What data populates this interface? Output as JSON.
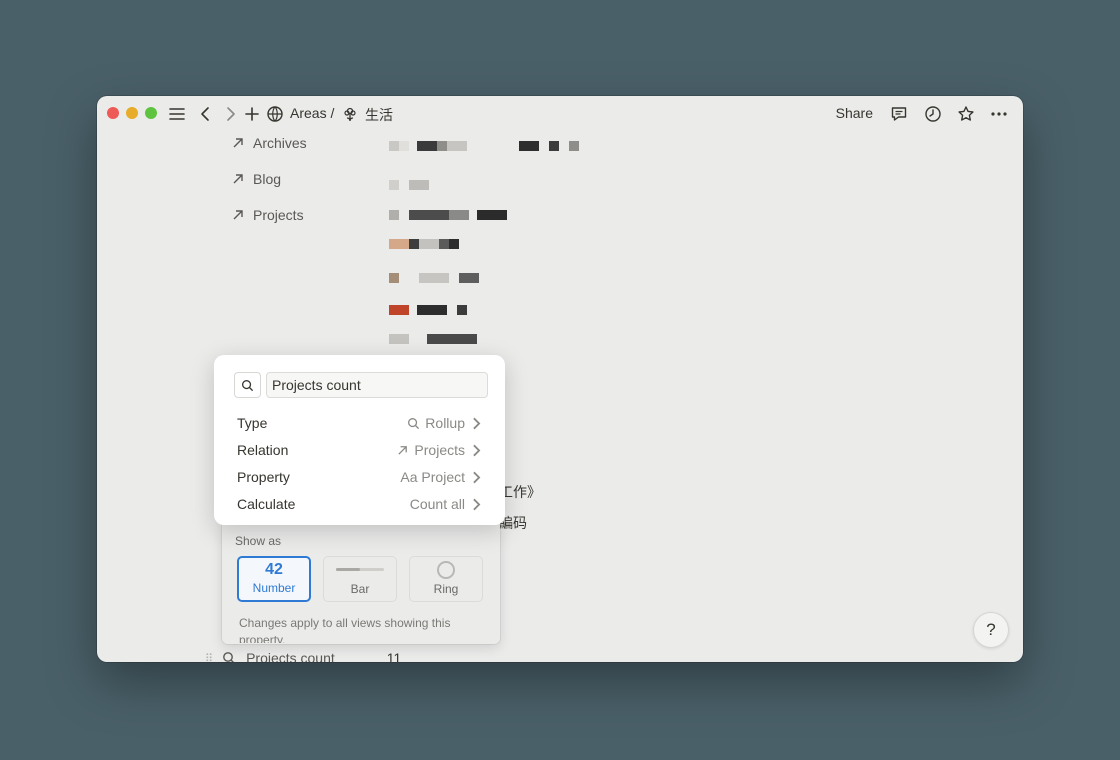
{
  "titlebar": {
    "breadcrumb_parent": "Areas /",
    "breadcrumb_page": "生活",
    "share_label": "Share"
  },
  "properties": [
    {
      "label": "Archives"
    },
    {
      "label": "Blog"
    },
    {
      "label": "Projects"
    }
  ],
  "background_text": {
    "frag1": "工作》",
    "frag2": "編码",
    "bottom_prop_label": "Projects count",
    "bottom_prop_value": "11"
  },
  "menu": {
    "name_value": "Projects count",
    "rows": [
      {
        "label": "Type",
        "value": "Rollup",
        "icon": "search-icon"
      },
      {
        "label": "Relation",
        "value": "Projects",
        "icon": "arrow-up-right-icon"
      },
      {
        "label": "Property",
        "value": "Aa Project",
        "icon": ""
      },
      {
        "label": "Calculate",
        "value": "Count all",
        "icon": ""
      }
    ],
    "show_as_label": "Show as",
    "options": [
      {
        "preview": "42",
        "label": "Number",
        "selected": true
      },
      {
        "label": "Bar",
        "selected": false
      },
      {
        "label": "Ring",
        "selected": false
      }
    ],
    "note": "Changes apply to all views showing this property."
  },
  "help_label": "?",
  "colors": {
    "accent": "#2f7ad4",
    "background": "#4a6069"
  }
}
